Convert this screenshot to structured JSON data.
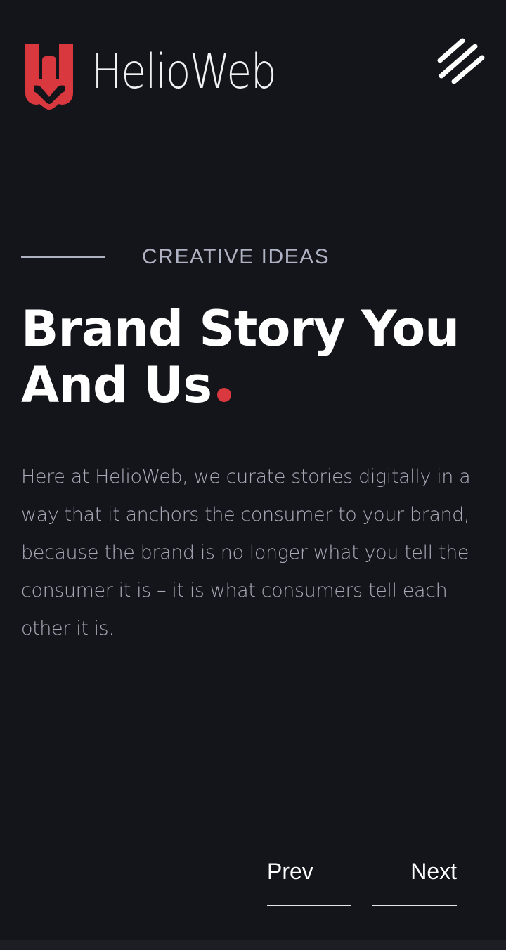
{
  "header": {
    "brand_name": "HelioWeb",
    "brand_color": "#d9383e",
    "menu_icon": "menu-slashes-icon"
  },
  "hero": {
    "eyebrow": "CREATIVE IDEAS",
    "title_line_1": "Brand Story You",
    "title_line_2": "And Us",
    "description": "Here at HelioWeb, we curate stories digitally in a way that it anchors the consumer to your brand, because the brand is no longer what you tell the consumer it is – it is what consumers tell each other it is."
  },
  "navigation": {
    "prev_label": "Prev",
    "next_label": "Next"
  },
  "colors": {
    "background": "#14151a",
    "accent": "#d9383e",
    "text_primary": "#ffffff",
    "text_muted": "#a7a9b7"
  }
}
